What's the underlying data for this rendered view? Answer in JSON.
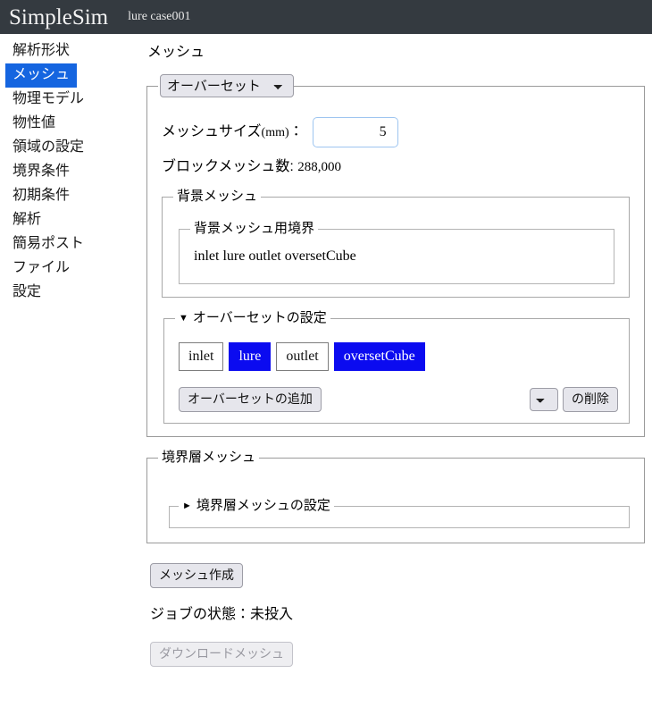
{
  "header": {
    "brand": "SimpleSim",
    "case_label": "lure case001",
    "bg_color": "#343a40"
  },
  "sidebar": {
    "items": [
      {
        "label": "解析形状",
        "active": false
      },
      {
        "label": "メッシュ",
        "active": true
      },
      {
        "label": "物理モデル",
        "active": false
      },
      {
        "label": "物性値",
        "active": false
      },
      {
        "label": "領域の設定",
        "active": false
      },
      {
        "label": "境界条件",
        "active": false
      },
      {
        "label": "初期条件",
        "active": false
      },
      {
        "label": "解析",
        "active": false
      },
      {
        "label": "簡易ポスト",
        "active": false
      },
      {
        "label": "ファイル",
        "active": false
      },
      {
        "label": "設定",
        "active": false
      }
    ],
    "active_color": "#1565e0"
  },
  "main": {
    "page_title": "メッシュ",
    "mesh_type": {
      "selected": "オーバーセット",
      "options": [
        "オーバーセット"
      ]
    },
    "mesh_size": {
      "label": "メッシュサイズ",
      "unit": "(mm)",
      "separator": "：",
      "value": "5",
      "placeholder": ""
    },
    "block_mesh": {
      "label": "ブロックメッシュ数",
      "separator": ":",
      "value": "288,000"
    },
    "background_mesh": {
      "legend": "背景メッシュ",
      "boundary": {
        "legend": "背景メッシュ用境界",
        "text": "inlet lure outlet oversetCube"
      }
    },
    "overset_config": {
      "legend": "オーバーセットの設定",
      "expanded": true,
      "toggle_glyph": "▼",
      "chips": [
        {
          "label": "inlet",
          "selected": false
        },
        {
          "label": "lure",
          "selected": true
        },
        {
          "label": "outlet",
          "selected": false
        },
        {
          "label": "oversetCube",
          "selected": true
        }
      ],
      "selected_color": "#0b0bf0",
      "add_button": "オーバーセットの追加",
      "delete_select": {
        "selected": "",
        "options": [
          ""
        ]
      },
      "delete_button": "の削除"
    },
    "boundary_layer": {
      "legend": "境界層メッシュ",
      "inner": {
        "legend": "境界層メッシュの設定",
        "expanded": false,
        "toggle_glyph": "►"
      }
    },
    "build_button": "メッシュ作成",
    "job_status": "ジョブの状態：未投入",
    "download_button": "ダウンロードメッシュ"
  }
}
